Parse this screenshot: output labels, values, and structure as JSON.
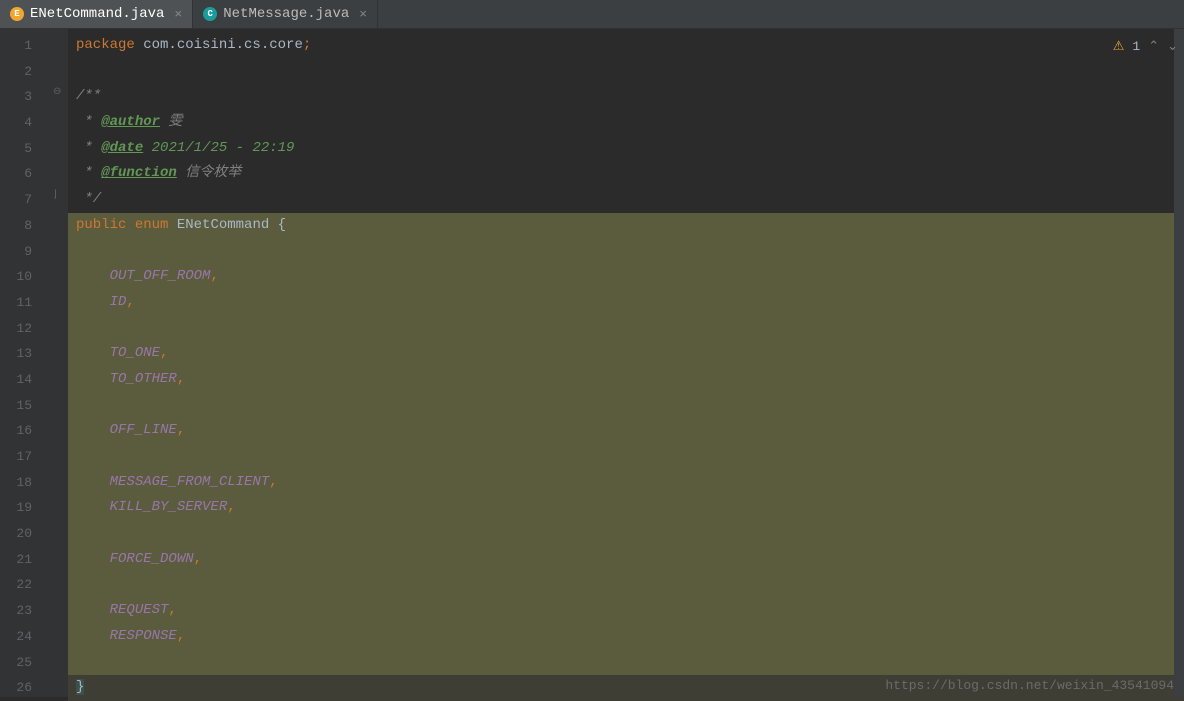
{
  "tabs": [
    {
      "label": "ENetCommand.java",
      "iconLetter": "E",
      "iconClass": "orange",
      "active": true
    },
    {
      "label": "NetMessage.java",
      "iconLetter": "C",
      "iconClass": "teal",
      "active": false
    }
  ],
  "warningCount": "1",
  "watermark": "https://blog.csdn.net/weixin_43541094",
  "code": {
    "packageKeyword": "package",
    "packageName": " com.coisini.cs.core",
    "semicolon": ";",
    "docStart": "/**",
    "docAuthorPrefix": " * ",
    "authorTag": "@author",
    "authorValue": " 雯",
    "dateTag": "@date",
    "dateValue": " 2021/1/25 - 22:19",
    "functionTag": "@function",
    "functionValue": " 信令枚举",
    "docEnd": " */",
    "publicKeyword": "public",
    "enumKeyword": " enum ",
    "enumName": "ENetCommand",
    "openBrace": " {",
    "closeBrace": "}",
    "indent": "    ",
    "indentStar": " * ",
    "values": {
      "v1": "OUT_OFF_ROOM",
      "v2": "ID",
      "v3": "TO_ONE",
      "v4": "TO_OTHER",
      "v5": "OFF_LINE",
      "v6": "MESSAGE_FROM_CLIENT",
      "v7": "KILL_BY_SERVER",
      "v8": "FORCE_DOWN",
      "v9": "REQUEST",
      "v10": "RESPONSE"
    },
    "comma": ","
  },
  "lineNumbers": [
    "1",
    "2",
    "3",
    "4",
    "5",
    "6",
    "7",
    "8",
    "9",
    "10",
    "11",
    "12",
    "13",
    "14",
    "15",
    "16",
    "17",
    "18",
    "19",
    "20",
    "21",
    "22",
    "23",
    "24",
    "25",
    "26"
  ]
}
